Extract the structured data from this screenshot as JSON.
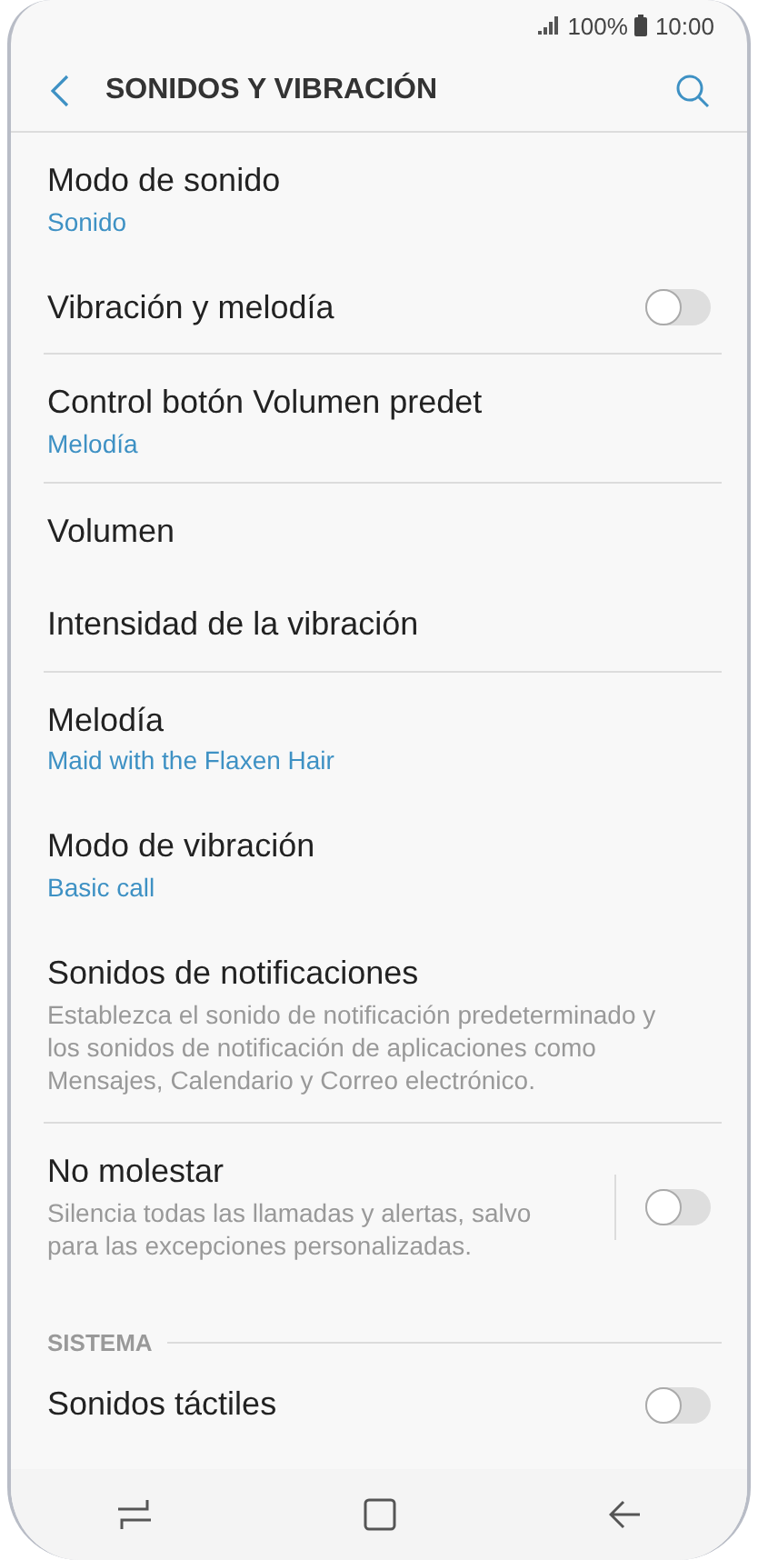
{
  "status_bar": {
    "battery": "100%",
    "time": "10:00"
  },
  "header": {
    "title": "SONIDOS Y VIBRACIÓN"
  },
  "groups": [
    {
      "items": [
        {
          "kind": "value",
          "title": "Modo de sonido",
          "value": "Sonido"
        },
        {
          "kind": "switch",
          "title": "Vibración y melodía",
          "on": false
        }
      ]
    },
    {
      "items": [
        {
          "kind": "value",
          "title": "Control botón Volumen predet",
          "value": "Melodía"
        }
      ]
    },
    {
      "items": [
        {
          "kind": "plain",
          "title": "Volumen"
        },
        {
          "kind": "plain",
          "title": "Intensidad de la vibración"
        }
      ]
    },
    {
      "items": [
        {
          "kind": "value",
          "title": "Melodía",
          "value": "Maid with the Flaxen Hair"
        },
        {
          "kind": "value",
          "title": "Modo de vibración",
          "value": "Basic call"
        },
        {
          "kind": "description",
          "title": "Sonidos de notificaciones",
          "description": "Establezca el sonido de notificación predeterminado y los sonidos de notificación de aplicaciones como Mensajes, Calendario y Correo electrónico."
        }
      ]
    },
    {
      "items": [
        {
          "kind": "switch",
          "title": "No molestar",
          "description": "Silencia todas las llamadas y alertas, salvo para las excepciones personalizadas.",
          "on": false
        }
      ]
    },
    {
      "section": "SISTEMA",
      "items": [
        {
          "kind": "switch",
          "title": "Sonidos táctiles",
          "on": false
        }
      ]
    }
  ]
}
